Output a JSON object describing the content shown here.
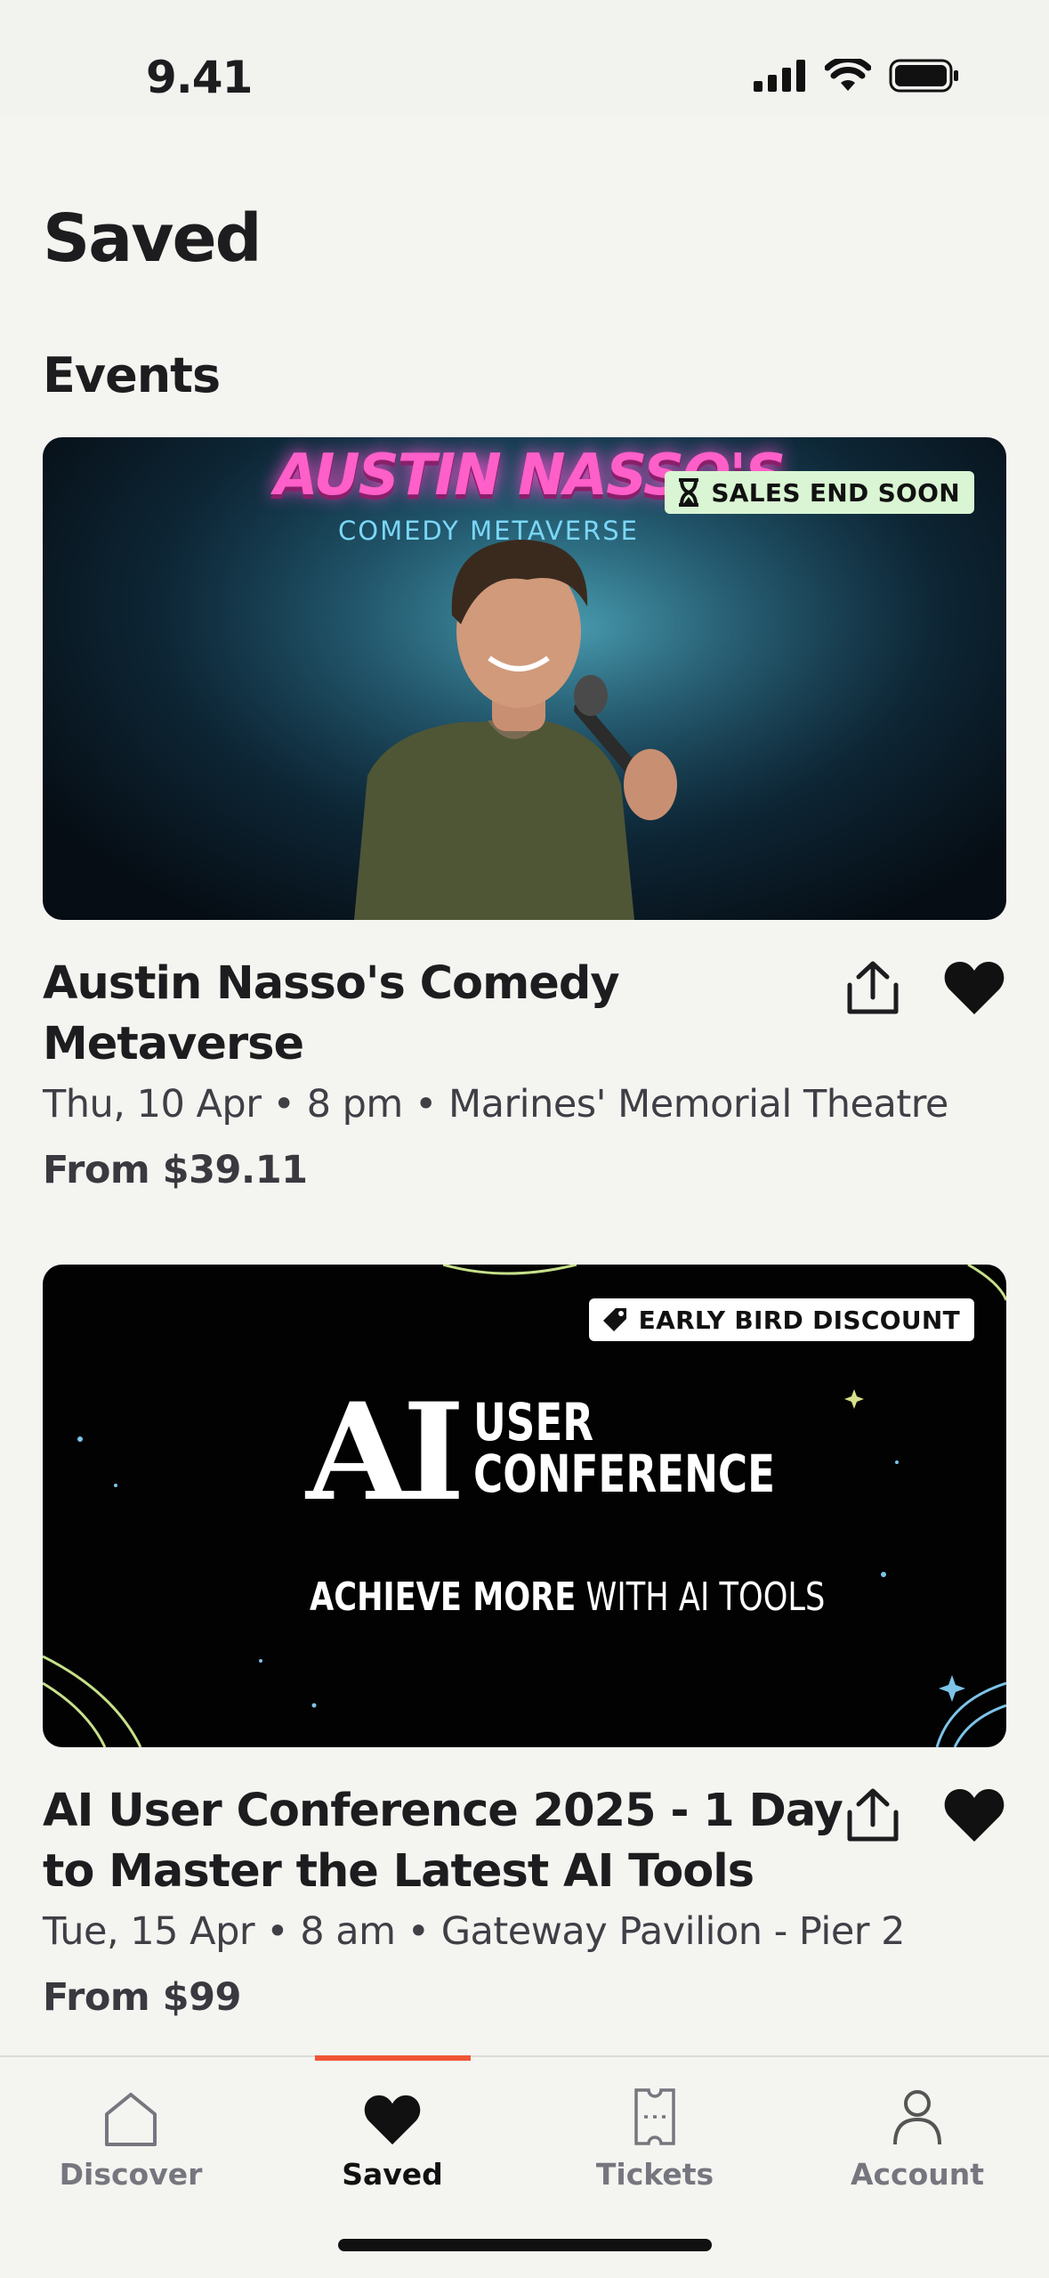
{
  "status_bar": {
    "time": "9.41"
  },
  "page": {
    "title": "Saved",
    "section_title": "Events"
  },
  "events": [
    {
      "image_title": "AUSTIN NASSO'S",
      "image_subtitle": "COMEDY METAVERSE",
      "badge": "SALES END SOON",
      "title": "Austin Nasso's Comedy Metaverse",
      "meta": "Thu, 10 Apr • 8 pm • Marines' Memorial Theatre",
      "price": "From $39.11"
    },
    {
      "image_logo": "AI",
      "image_title_line1": "USER",
      "image_title_line2": "CONFERENCE",
      "image_tagline_bold": "ACHIEVE MORE",
      "image_tagline_light": "WITH AI TOOLS",
      "badge": "EARLY BIRD DISCOUNT",
      "title": "AI User Conference 2025 - 1 Day to Master the Latest AI Tools",
      "meta": "Tue, 15 Apr • 8 am • Gateway Pavilion - Pier 2",
      "price": "From $99"
    }
  ],
  "tab_bar": {
    "active_tab": "Saved",
    "accent_color": "#f05537",
    "tabs": [
      {
        "label": "Discover",
        "icon": "home-icon"
      },
      {
        "label": "Saved",
        "icon": "heart-icon"
      },
      {
        "label": "Tickets",
        "icon": "ticket-icon"
      },
      {
        "label": "Account",
        "icon": "person-icon"
      }
    ]
  }
}
